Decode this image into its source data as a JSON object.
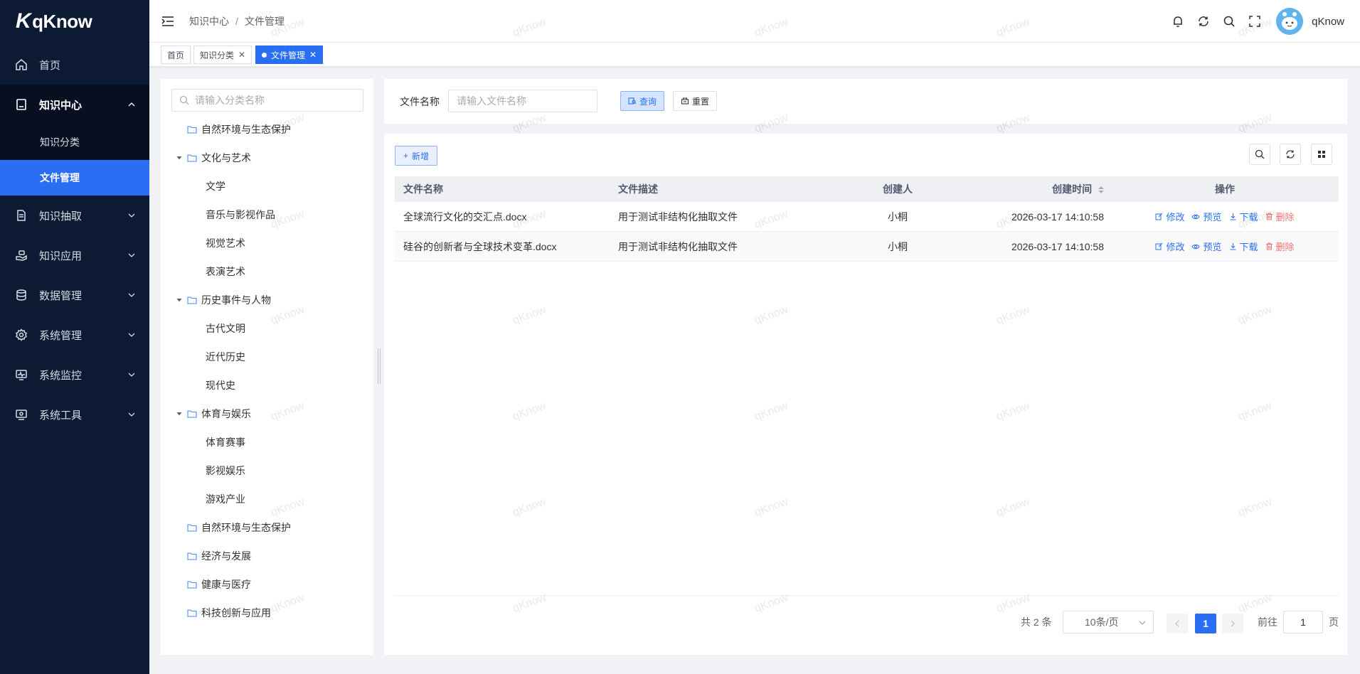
{
  "app": {
    "logo_text": "qKnow",
    "logo_mark": "K"
  },
  "sidebar": {
    "items": [
      {
        "label": "首页",
        "icon": "home-icon"
      },
      {
        "label": "知识中心",
        "icon": "book-icon",
        "open": true,
        "children": [
          {
            "label": "知识分类"
          },
          {
            "label": "文件管理",
            "active": true
          }
        ]
      },
      {
        "label": "知识抽取",
        "icon": "document-extract-icon"
      },
      {
        "label": "知识应用",
        "icon": "hand-icon"
      },
      {
        "label": "数据管理",
        "icon": "database-icon"
      },
      {
        "label": "系统管理",
        "icon": "gear-icon"
      },
      {
        "label": "系统监控",
        "icon": "monitor-icon"
      },
      {
        "label": "系统工具",
        "icon": "toolbox-icon"
      }
    ]
  },
  "header": {
    "breadcrumb": [
      "知识中心",
      "文件管理"
    ],
    "breadcrumb_sep": "/",
    "username": "qKnow"
  },
  "tags": [
    {
      "label": "首页",
      "closable": false
    },
    {
      "label": "知识分类",
      "closable": true
    },
    {
      "label": "文件管理",
      "closable": true,
      "active": true
    }
  ],
  "tree": {
    "search_placeholder": "请输入分类名称",
    "nodes": [
      {
        "label": "自然环境与生态保护",
        "level": 0,
        "folder": true
      },
      {
        "label": "文化与艺术",
        "level": 0,
        "folder": true,
        "expanded": true
      },
      {
        "label": "文学",
        "level": 1
      },
      {
        "label": "音乐与影视作品",
        "level": 1
      },
      {
        "label": "视觉艺术",
        "level": 1
      },
      {
        "label": "表演艺术",
        "level": 1
      },
      {
        "label": "历史事件与人物",
        "level": 0,
        "folder": true,
        "expanded": true
      },
      {
        "label": "古代文明",
        "level": 1
      },
      {
        "label": "近代历史",
        "level": 1
      },
      {
        "label": "现代史",
        "level": 1
      },
      {
        "label": "体育与娱乐",
        "level": 0,
        "folder": true,
        "expanded": true
      },
      {
        "label": "体育赛事",
        "level": 1
      },
      {
        "label": "影视娱乐",
        "level": 1
      },
      {
        "label": "游戏产业",
        "level": 1
      },
      {
        "label": "自然环境与生态保护",
        "level": 0,
        "folder": true
      },
      {
        "label": "经济与发展",
        "level": 0,
        "folder": true
      },
      {
        "label": "健康与医疗",
        "level": 0,
        "folder": true
      },
      {
        "label": "科技创新与应用",
        "level": 0,
        "folder": true
      }
    ]
  },
  "search_form": {
    "label": "文件名称",
    "placeholder": "请输入文件名称",
    "query_label": "查询",
    "reset_label": "重置"
  },
  "table": {
    "add_label": "新增",
    "columns": [
      "文件名称",
      "文件描述",
      "创建人",
      "创建时间",
      "操作"
    ],
    "rows": [
      {
        "name": "全球流行文化的交汇点.docx",
        "desc": "用于测试非结构化抽取文件",
        "creator": "小桐",
        "time": "2026-03-17 14:10:58"
      },
      {
        "name": "硅谷的创新者与全球技术变革.docx",
        "desc": "用于测试非结构化抽取文件",
        "creator": "小桐",
        "time": "2026-03-17 14:10:58"
      }
    ],
    "actions": {
      "edit": "修改",
      "preview": "预览",
      "download": "下载",
      "delete": "删除"
    }
  },
  "pagination": {
    "total_text": "共 2 条",
    "page_size": "10条/页",
    "current_page": "1",
    "goto_prefix": "前往",
    "goto_value": "1",
    "goto_suffix": "页"
  },
  "watermark": "qKnow",
  "colors": {
    "primary": "#2a6ff3",
    "sidebar_bg": "#0c1a33",
    "danger": "#f56c6c"
  }
}
